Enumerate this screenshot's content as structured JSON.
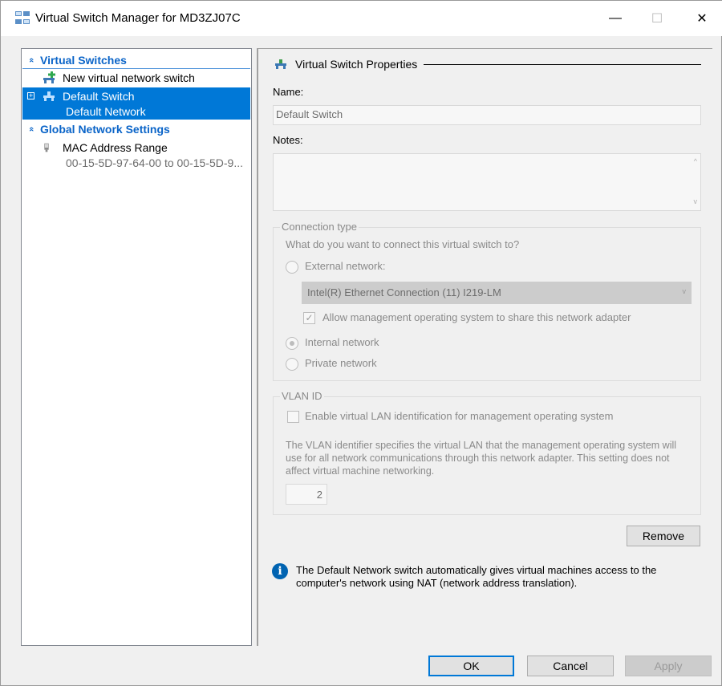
{
  "window": {
    "title": "Virtual Switch Manager for MD3ZJ07C",
    "min_glyph": "—",
    "max_glyph": "☐",
    "close_glyph": "✕"
  },
  "tree": {
    "virtual_switches_header": "Virtual Switches",
    "new_switch_label": "New virtual network switch",
    "default_switch": {
      "label": "Default Switch",
      "sub": "Default Network"
    },
    "global_settings_header": "Global Network Settings",
    "mac_range": {
      "label": "MAC Address Range",
      "sub": "00-15-5D-97-64-00 to 00-15-5D-9..."
    }
  },
  "properties": {
    "section_title": "Virtual Switch Properties",
    "name_label": "Name:",
    "name_value": "Default Switch",
    "notes_label": "Notes:",
    "notes_value": "",
    "connection_type": {
      "legend": "Connection type",
      "question": "What do you want to connect this virtual switch to?",
      "external_label": "External network:",
      "adapter_selected": "Intel(R) Ethernet Connection (11) I219-LM",
      "allow_mgmt_label": "Allow management operating system to share this network adapter",
      "internal_label": "Internal network",
      "private_label": "Private network",
      "selected": "internal"
    },
    "vlan": {
      "legend": "VLAN ID",
      "enable_label": "Enable virtual LAN identification for management operating system",
      "description": "The VLAN identifier specifies the virtual LAN that the management operating system will use for all network communications through this network adapter. This setting does not affect virtual machine networking.",
      "id_value": "2"
    },
    "remove_label": "Remove",
    "info_text": "The Default Network switch automatically gives virtual machines access to the computer's network using NAT (network address translation)."
  },
  "footer": {
    "ok_label": "OK",
    "cancel_label": "Cancel",
    "apply_label": "Apply"
  },
  "icons": {
    "chevron": "«",
    "expander": "+",
    "check": "✓",
    "info": "i",
    "scroll_up": "^",
    "scroll_down": "v",
    "combo_arrow": "v"
  },
  "colors": {
    "accent": "#0078d7",
    "header_blue": "#0a64c8",
    "info_blue": "#0063b1"
  }
}
